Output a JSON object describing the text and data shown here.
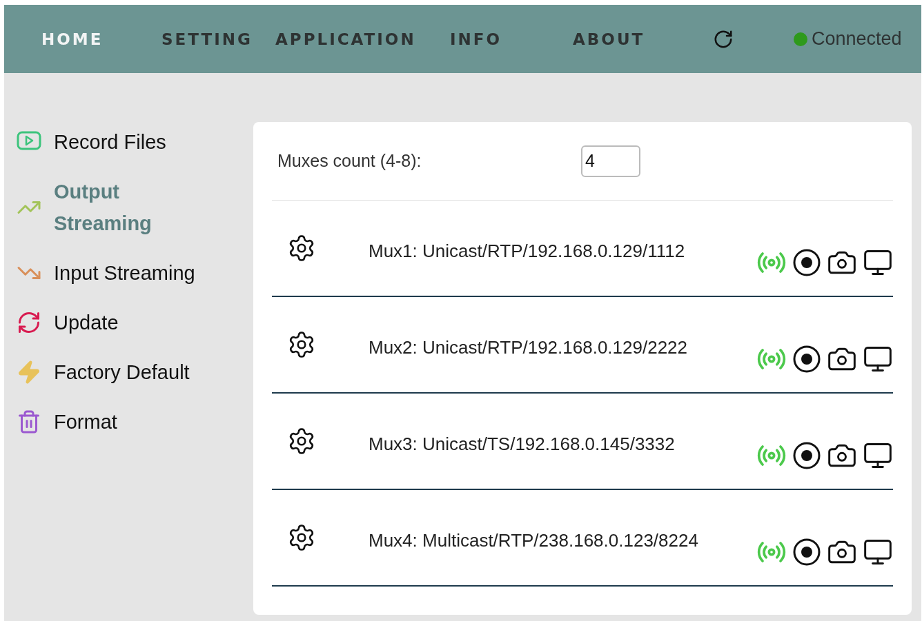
{
  "nav": {
    "items": [
      {
        "label": "HOME",
        "selected": true
      },
      {
        "label": "SETTING",
        "selected": false
      },
      {
        "label": "APPLICATION",
        "selected": false
      },
      {
        "label": "INFO",
        "selected": false
      },
      {
        "label": "ABOUT",
        "selected": false
      }
    ],
    "status": {
      "label": "Connected",
      "connected": true
    }
  },
  "sidebar": {
    "items": [
      {
        "label": "Record Files",
        "kind": "video",
        "color": "#3cc47c",
        "selected": false
      },
      {
        "label": "Output Streaming",
        "kind": "trend-up",
        "color": "#a3c45a",
        "selected": true
      },
      {
        "label": "Input Streaming",
        "kind": "trend-down",
        "color": "#d9905a",
        "selected": false
      },
      {
        "label": "Update",
        "kind": "refresh",
        "color": "#d81b50",
        "selected": false
      },
      {
        "label": "Factory Default",
        "kind": "bolt",
        "color": "#e8c25a",
        "selected": false
      },
      {
        "label": "Format",
        "kind": "trash",
        "color": "#9b59d0",
        "selected": false
      }
    ]
  },
  "muxes_count": {
    "label": "Muxes count (4-8):",
    "value": "4"
  },
  "muxes": [
    {
      "label": "Mux1: Unicast/RTP/192.168.0.129/1112"
    },
    {
      "label": "Mux2: Unicast/RTP/192.168.0.129/2222"
    },
    {
      "label": "Mux3: Unicast/TS/192.168.0.145/3332"
    },
    {
      "label": "Mux4: Multicast/RTP/238.168.0.123/8224"
    }
  ]
}
